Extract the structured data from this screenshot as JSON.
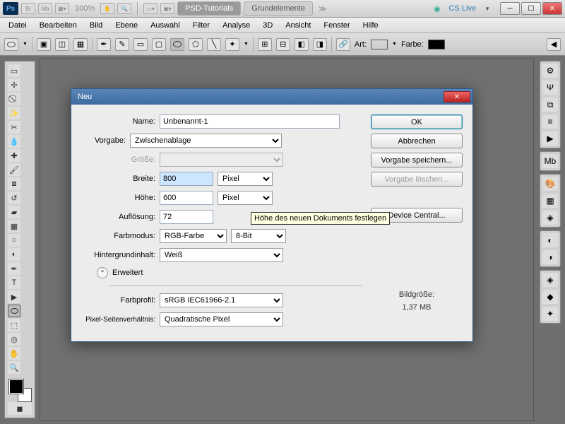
{
  "top": {
    "ps": "Ps",
    "br": "Br",
    "mb": "Mb",
    "zoom": "100%",
    "tab_active": "PSD-Tutorials",
    "tab2": "Grundelemente",
    "cslive": "CS Live"
  },
  "menu": [
    "Datei",
    "Bearbeiten",
    "Bild",
    "Ebene",
    "Auswahl",
    "Filter",
    "Analyse",
    "3D",
    "Ansicht",
    "Fenster",
    "Hilfe"
  ],
  "optbar": {
    "art": "Art:",
    "farbe": "Farbe:",
    "swatch_color": "#000000",
    "art_swatch": "#888888"
  },
  "dialog": {
    "title": "Neu",
    "name_label": "Name:",
    "name_value": "Unbenannt-1",
    "vorgabe_label": "Vorgabe:",
    "vorgabe_value": "Zwischenablage",
    "groesse_label": "Größe:",
    "groesse_value": "",
    "breite_label": "Breite:",
    "breite_value": "800",
    "breite_unit": "Pixel",
    "hoehe_label": "Höhe:",
    "hoehe_value": "600",
    "hoehe_unit": "Pixel",
    "aufloesung_label": "Auflösung:",
    "aufloesung_value": "72",
    "farbmodus_label": "Farbmodus:",
    "farbmodus_value": "RGB-Farbe",
    "farbmodus_bit": "8-Bit",
    "hg_label": "Hintergrundinhalt:",
    "hg_value": "Weiß",
    "erweitert": "Erweitert",
    "farbprofil_label": "Farbprofil:",
    "farbprofil_value": "sRGB IEC61966-2.1",
    "pixelar_label": "Pixel-Seitenverhältnis:",
    "pixelar_value": "Quadratische Pixel",
    "ok": "OK",
    "abbrechen": "Abbrechen",
    "vorgabe_speichern": "Vorgabe speichern...",
    "vorgabe_loeschen": "Vorgabe löschen...",
    "device_central": "Device Central...",
    "bildgroesse_label": "Bildgröße:",
    "bildgroesse_value": "1,37 MB",
    "tooltip": "Höhe des neuen Dokuments festlegen"
  }
}
